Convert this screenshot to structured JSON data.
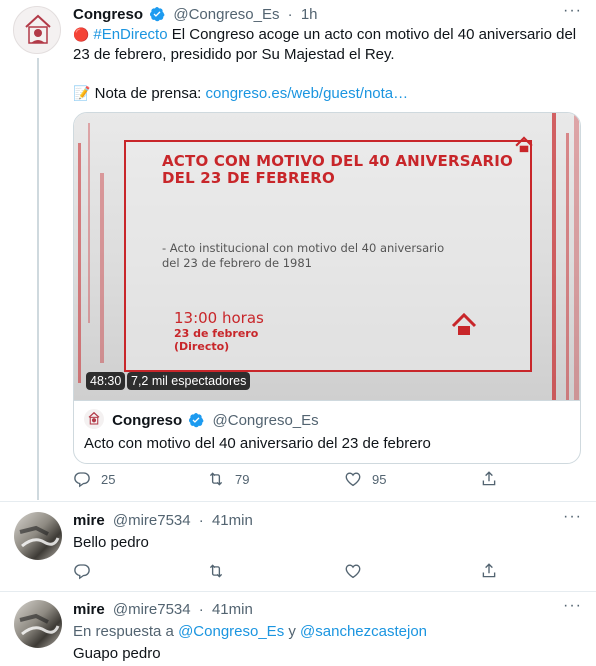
{
  "main_tweet": {
    "name": "Congreso",
    "handle": "@Congreso_Es",
    "separator": "·",
    "time": "1h",
    "live_dot": "🔴",
    "hashtag": "#EnDirecto",
    "text_line1": " El Congreso acoge un acto con motivo del 40 aniversario del",
    "text_line2": "23 de febrero, presidido por Su Majestad el Rey.",
    "press_emoji": "📝",
    "press_label": "Nota de prensa: ",
    "press_link": "congreso.es/web/guest/nota…",
    "video": {
      "title_line1": "ACTO CON MOTIVO DEL 40 ANIVERSARIO",
      "title_line2": "DEL 23 DE FEBRERO",
      "desc_line1": "- Acto institucional con motivo del 40 aniversario",
      "desc_line2": "del 23 de febrero de 1981",
      "time": "13:00 horas",
      "date_line1": "23 de febrero",
      "date_line2": "(Directo)",
      "duration": "48:30",
      "viewers": "7,2 mil espectadores"
    },
    "quote": {
      "name": "Congreso",
      "handle": "@Congreso_Es",
      "text": "Acto con motivo del 40 aniversario del 23 de febrero"
    },
    "replies": "25",
    "retweets": "79",
    "likes": "95"
  },
  "reply1": {
    "name": "mire",
    "handle": "@mire7534",
    "separator": "·",
    "time": "41min",
    "text": "Bello pedro"
  },
  "reply2": {
    "name": "mire",
    "handle": "@mire7534",
    "separator": "·",
    "time": "41min",
    "in_reply_prefix": "En respuesta a ",
    "mention1": "@Congreso_Es",
    "and": " y ",
    "mention2": "@sanchezcastejon",
    "text": "Guapo pedro"
  },
  "colors": {
    "accent": "#1b95e0",
    "verified": "#1d9bf0",
    "brand_red": "#c8262a",
    "muted": "#536471"
  },
  "icons": [
    "reply-icon",
    "retweet-icon",
    "like-icon",
    "share-icon",
    "more-icon",
    "verified-icon"
  ]
}
